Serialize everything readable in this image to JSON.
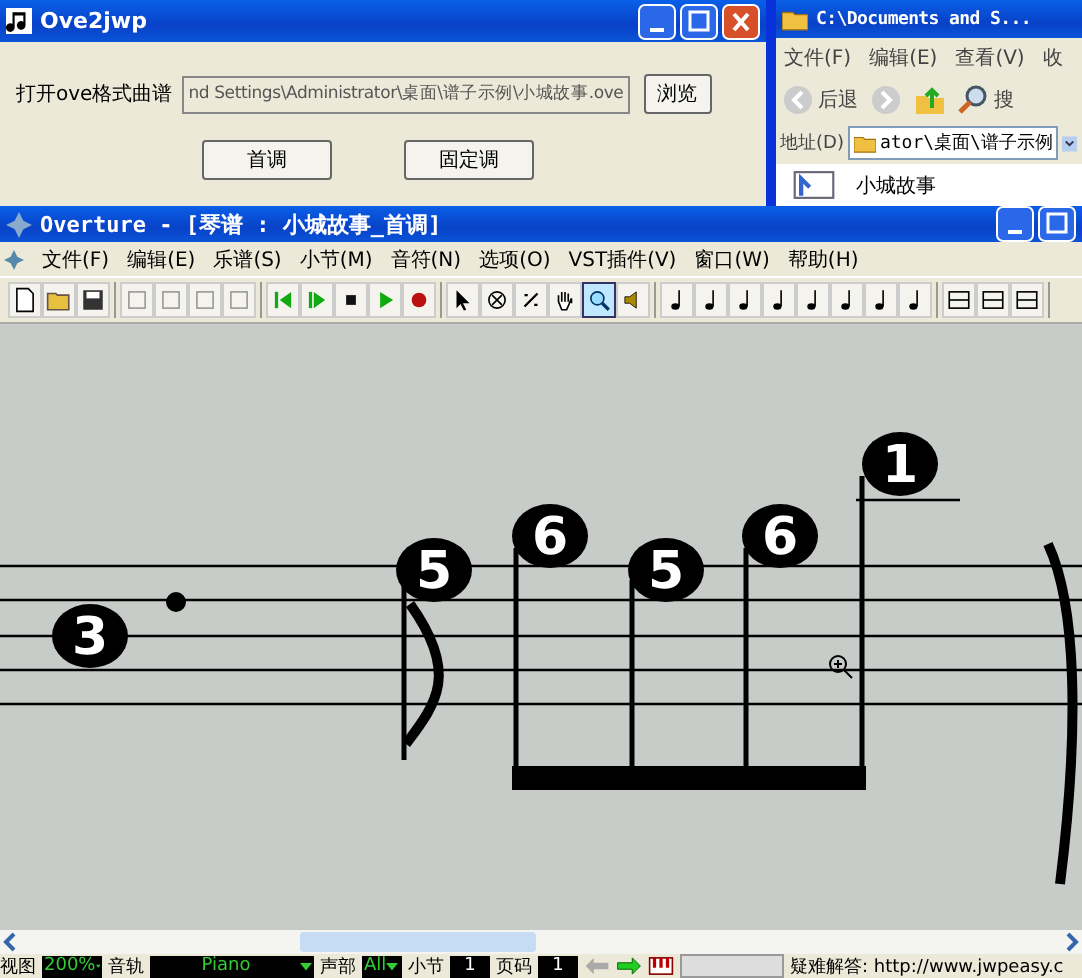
{
  "converter_window": {
    "title": "Ove2jwp",
    "file_label": "打开ove格式曲谱",
    "file_path": "nd Settings\\Administrator\\桌面\\谱子示例\\小城故事.ove",
    "browse_button": "浏览",
    "buttons": [
      "首调",
      "固定调"
    ]
  },
  "explorer_window": {
    "title": "C:\\Documents and S...",
    "menu": [
      "文件(F)",
      "编辑(E)",
      "查看(V)",
      "收"
    ],
    "back_label": "后退",
    "search_label": "搜",
    "address_label": "地址(D)",
    "address": "ator\\桌面\\谱子示例",
    "file_name": "小城故事"
  },
  "main_window": {
    "title": "Overture - [琴谱 : 小城故事_首调]",
    "menu": [
      "文件(F)",
      "编辑(E)",
      "乐谱(S)",
      "小节(M)",
      "音符(N)",
      "选项(O)",
      "VST插件(V)",
      "窗口(W)",
      "帮助(H)"
    ],
    "tools": [
      {
        "selected": false
      },
      {
        "selected": false
      },
      {
        "selected": false
      },
      {
        "selected": false
      },
      {
        "selected": true
      },
      {
        "selected": false
      }
    ],
    "notes": [
      "3",
      "5",
      "6",
      "5",
      "6",
      "1"
    ],
    "status_bar": {
      "view_label": "视图",
      "zoom": "200%",
      "track_label": "音轨",
      "track": "Piano",
      "voice_label": "声部",
      "voice": "All",
      "measure_label": "小节",
      "measure": "1",
      "page_label": "页码",
      "page": "1",
      "help_text": "疑难解答: http://www.jwpeasy.c"
    }
  }
}
